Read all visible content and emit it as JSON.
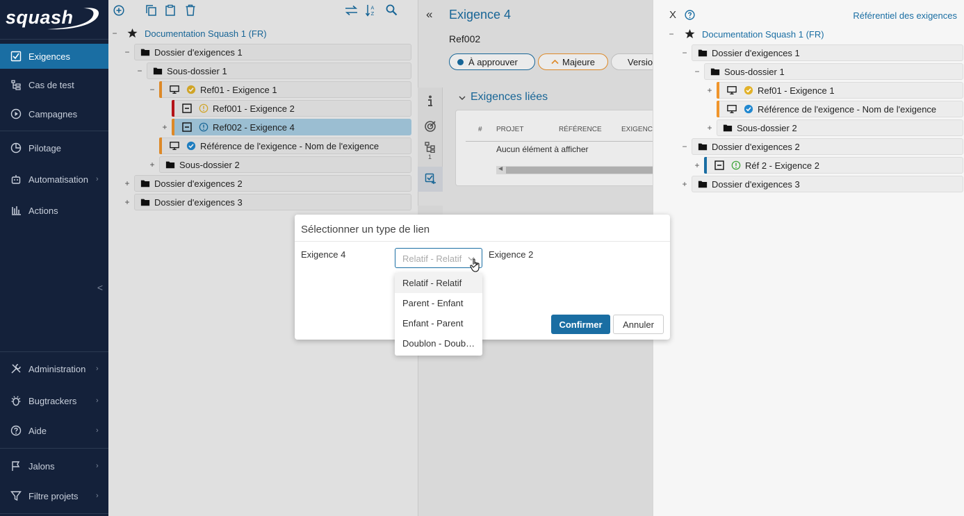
{
  "brand": {
    "logo_text": "squash"
  },
  "sidebar": {
    "items": [
      {
        "label": "Exigences",
        "icon": "checklist-icon",
        "active": true
      },
      {
        "label": "Cas de test",
        "icon": "test-tree-icon"
      },
      {
        "label": "Campagnes",
        "icon": "play-circle-icon"
      },
      {
        "label": "Pilotage",
        "icon": "pie-chart-icon"
      },
      {
        "label": "Automatisation",
        "icon": "robot-icon",
        "chevron": true
      },
      {
        "label": "Actions",
        "icon": "bar-chart-icon"
      },
      {
        "label": "Administration",
        "icon": "tools-icon",
        "chevron": true
      },
      {
        "label": "Bugtrackers",
        "icon": "bug-icon",
        "chevron": true
      },
      {
        "label": "Aide",
        "icon": "help-icon",
        "chevron": true
      },
      {
        "label": "Jalons",
        "icon": "flag-icon",
        "chevron": true
      },
      {
        "label": "Filtre projets",
        "icon": "filter-icon",
        "chevron": true
      }
    ],
    "collapse_glyph": "<"
  },
  "left_tree": {
    "project": "Documentation Squash 1 (FR)",
    "nodes": [
      "Dossier d'exigences 1",
      "Sous-dossier 1",
      "Ref01 - Exigence 1",
      "Ref001 - Exigence 2",
      "Ref002 - Exigence 4",
      "Référence de l'exigence - Nom de l'exigence",
      "Sous-dossier 2",
      "Dossier d'exigences 2",
      "Dossier d'exigences 3"
    ]
  },
  "detail": {
    "collapse_glyph": "«",
    "title": "Exigence 4",
    "reference": "Ref002",
    "status_pill": "À approuver",
    "criticality_pill": "Majeure",
    "version_pill": "Version",
    "linked_section": "Exigences liées",
    "table_headers": [
      "#",
      "PROJET",
      "RÉFÉRENCE",
      "EXIGENCE"
    ],
    "empty_text": "Aucun élément à afficher",
    "tab_badge": "1"
  },
  "right_panel": {
    "close_glyph": "X",
    "link_label": "Référentiel des exigences",
    "project": "Documentation Squash 1 (FR)",
    "nodes": [
      "Dossier d'exigences 1",
      "Sous-dossier 1",
      "Ref01 - Exigence 1",
      "Référence de l'exigence - Nom de l'exigence",
      "Sous-dossier 2",
      "Dossier d'exigences 2",
      "Réf 2 - Exigence 2",
      "Dossier d'exigences 3"
    ]
  },
  "dialog": {
    "title": "Sélectionner un type de lien",
    "source": "Exigence 4",
    "target": "Exigence 2",
    "select_value": "Relatif - Relatif",
    "options": [
      "Relatif - Relatif",
      "Parent - Enfant",
      "Enfant - Parent",
      "Doublon - Doublon"
    ],
    "confirm": "Confirmer",
    "cancel": "Annuler"
  },
  "colors": {
    "sidebar_bg": "#14213a",
    "active_nav": "#1a6ea3",
    "primary": "#1a6ea3",
    "stripe_orange": "#f0952c",
    "stripe_red": "#c4161c",
    "stripe_blue": "#1a6ea3",
    "selected_node": "#a9cfe4"
  }
}
